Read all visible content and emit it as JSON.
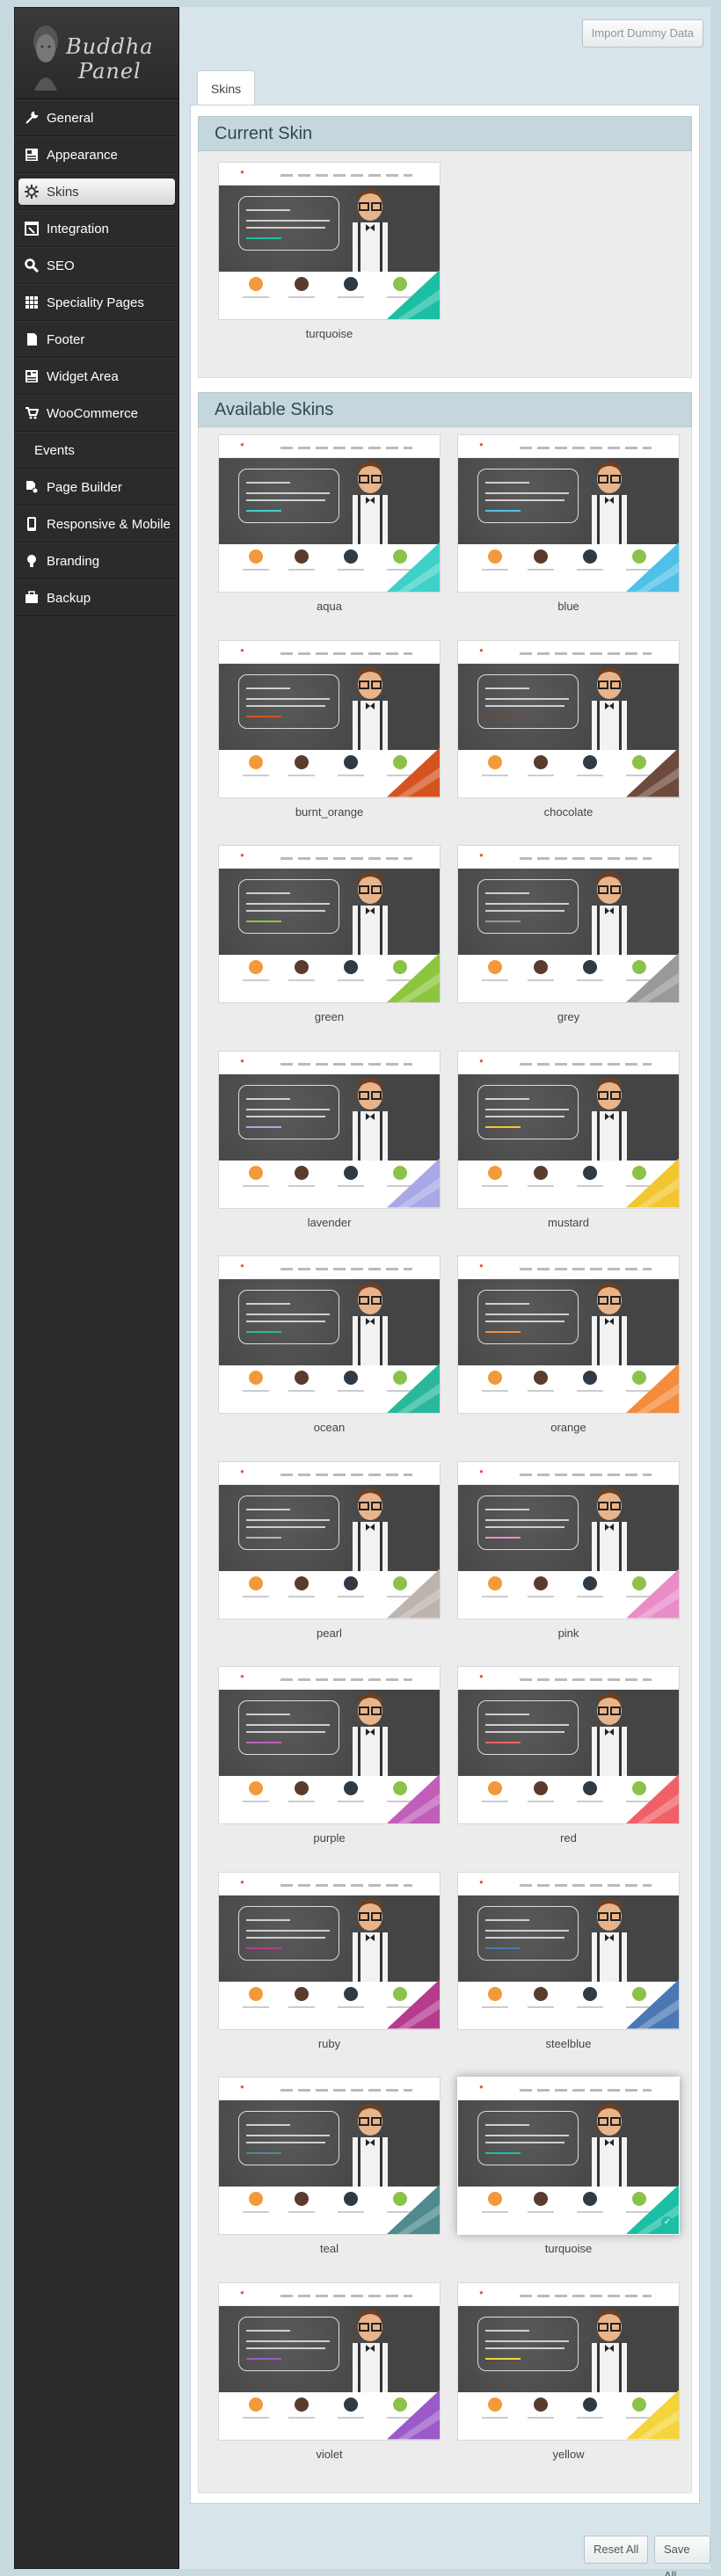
{
  "logo": {
    "line1": "Buddha",
    "line2": "Panel"
  },
  "menu": [
    {
      "label": "General",
      "icon": "tools-icon"
    },
    {
      "label": "Appearance",
      "icon": "appearance-icon"
    },
    {
      "label": "Skins",
      "icon": "gear-icon",
      "active": true
    },
    {
      "label": "Integration",
      "icon": "integration-icon"
    },
    {
      "label": "SEO",
      "icon": "search-icon"
    },
    {
      "label": "Speciality Pages",
      "icon": "grid-icon"
    },
    {
      "label": "Footer",
      "icon": "footer-icon"
    },
    {
      "label": "Widget Area",
      "icon": "widget-icon"
    },
    {
      "label": "WooCommerce",
      "icon": "cart-icon"
    },
    {
      "label": "Events",
      "icon": ""
    },
    {
      "label": "Page Builder",
      "icon": "page-builder-icon"
    },
    {
      "label": "Responsive & Mobile",
      "icon": "mobile-icon"
    },
    {
      "label": "Branding",
      "icon": "bulb-icon"
    },
    {
      "label": "Backup",
      "icon": "briefcase-icon"
    }
  ],
  "header": {
    "import_label": "Import Dummy Data",
    "tab_label": "Skins"
  },
  "current_section": {
    "title": "Current Skin",
    "skin": {
      "name": "turquoise",
      "color": "#1cbfa4"
    }
  },
  "available_section": {
    "title": "Available Skins",
    "skins": [
      {
        "name": "aqua",
        "color": "#3fd0c9"
      },
      {
        "name": "blue",
        "color": "#4fc0e8"
      },
      {
        "name": "burnt_orange",
        "color": "#d4541f"
      },
      {
        "name": "chocolate",
        "color": "#6e4a3c"
      },
      {
        "name": "green",
        "color": "#8cc63f"
      },
      {
        "name": "grey",
        "color": "#999999"
      },
      {
        "name": "lavender",
        "color": "#a8a8e6"
      },
      {
        "name": "mustard",
        "color": "#f2c62f"
      },
      {
        "name": "ocean",
        "color": "#2ab89c"
      },
      {
        "name": "orange",
        "color": "#f58c3c"
      },
      {
        "name": "pearl",
        "color": "#bfb3ad"
      },
      {
        "name": "pink",
        "color": "#e98dc8"
      },
      {
        "name": "purple",
        "color": "#c05fb9"
      },
      {
        "name": "red",
        "color": "#f06167"
      },
      {
        "name": "ruby",
        "color": "#b53b8f"
      },
      {
        "name": "steelblue",
        "color": "#4a78b5"
      },
      {
        "name": "teal",
        "color": "#4e8a8e"
      },
      {
        "name": "turquoise",
        "color": "#1cbfa4",
        "selected": true
      },
      {
        "name": "violet",
        "color": "#9b59c9"
      },
      {
        "name": "yellow",
        "color": "#f4d43a"
      }
    ]
  },
  "footer": {
    "reset_label": "Reset All",
    "save_label": "Save All"
  }
}
